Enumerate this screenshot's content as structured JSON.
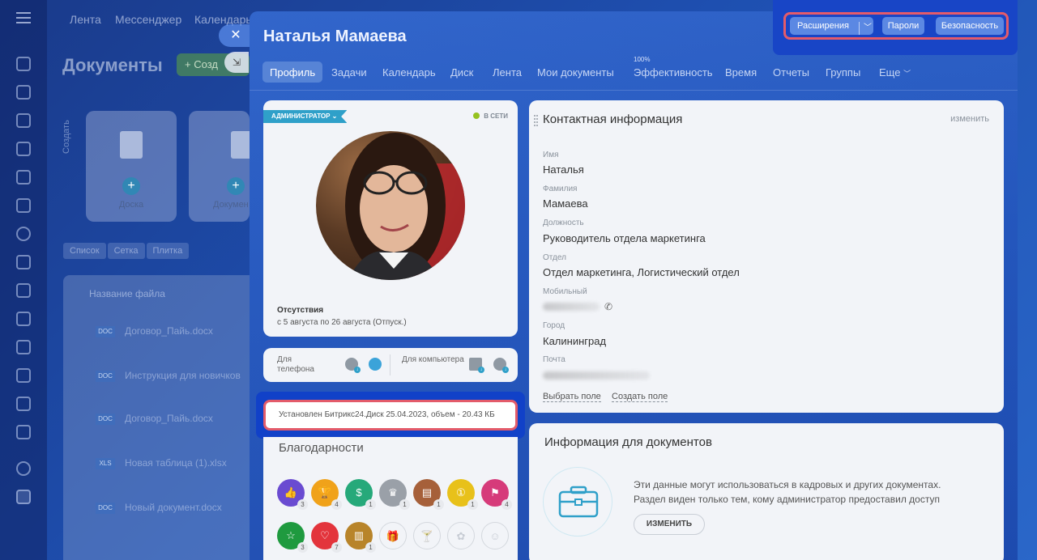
{
  "background": {
    "nav": [
      "Лента",
      "Мессенджер",
      "Календарь"
    ],
    "page_title": "Документы",
    "create_button": "Созд",
    "create_vertical": "Создать",
    "cards": [
      {
        "badge": "BOARD",
        "label": "Доска"
      },
      {
        "badge": "DOC",
        "label": "Докумен"
      }
    ],
    "views": [
      "Список",
      "Сетка",
      "Плитка"
    ],
    "table_header": "Название файла",
    "rows": [
      {
        "badge": "DOC",
        "name": "Договор_Пайь.docx"
      },
      {
        "badge": "DOC",
        "name": "Инструкция для новичков"
      },
      {
        "badge": "DOC",
        "name": "Договор_Пайь.docx"
      },
      {
        "badge": "XLS",
        "name": "Новая таблица (1).xlsx"
      },
      {
        "badge": "DOC",
        "name": "Новый документ.docx"
      }
    ],
    "close_symbol": "✕",
    "expand_symbol": "⇲"
  },
  "profile": {
    "title": "Наталья Мамаева",
    "tabs": [
      {
        "label": "Профиль",
        "active": true
      },
      {
        "label": "Задачи"
      },
      {
        "label": "Календарь"
      },
      {
        "label": "Диск"
      },
      {
        "label": "Лента"
      },
      {
        "label": "Мои документы"
      },
      {
        "label": "Эффективность",
        "superscript": "100%"
      },
      {
        "label": "Время"
      },
      {
        "label": "Отчеты"
      },
      {
        "label": "Группы"
      },
      {
        "label": "Еще"
      }
    ]
  },
  "avatar_card": {
    "role_badge": "АДМИНИСТРАТОР",
    "status": "В СЕТИ",
    "absence_title": "Отсутствия",
    "absence_text": "с 5 августа по 26 августа (Отпуск.)"
  },
  "apps_card": {
    "phone_label": "Для телефона",
    "computer_label": "Для компьютера"
  },
  "install_notice": "Установлен Битрикс24.Диск 25.04.2023, объем - 20.43 КБ",
  "thanks": {
    "title": "Благодарности",
    "row1": [
      {
        "icon": "thumbs-up",
        "count": "3",
        "color": "#6a4bd1"
      },
      {
        "icon": "trophy",
        "count": "4",
        "color": "#f0a21a"
      },
      {
        "icon": "money",
        "count": "1",
        "color": "#26a97a"
      },
      {
        "icon": "crown",
        "count": "1",
        "color": "#9aa0a8"
      },
      {
        "icon": "cake",
        "count": "1",
        "color": "#a6603a"
      },
      {
        "icon": "coin",
        "count": "1",
        "color": "#e8c11a"
      },
      {
        "icon": "flag",
        "count": "4",
        "color": "#d63b7a"
      }
    ],
    "row2": [
      {
        "icon": "star",
        "count": "3",
        "color": "#1f9a3f"
      },
      {
        "icon": "heart",
        "count": "7",
        "color": "#e3343c"
      },
      {
        "icon": "beer",
        "count": "1",
        "color": "#b8842a"
      },
      {
        "icon": "gift",
        "count": "",
        "color": ""
      },
      {
        "icon": "cocktail",
        "count": "",
        "color": ""
      },
      {
        "icon": "flower",
        "count": "",
        "color": ""
      },
      {
        "icon": "smile",
        "count": "",
        "color": ""
      }
    ]
  },
  "contact": {
    "title": "Контактная информация",
    "edit": "изменить",
    "fields": [
      {
        "label": "Имя",
        "value": "Наталья"
      },
      {
        "label": "Фамилия",
        "value": "Мамаева"
      },
      {
        "label": "Должность",
        "value": "Руководитель отдела маркетинга"
      },
      {
        "label": "Отдел",
        "value": "Отдел маркетинга, Логистический отдел"
      },
      {
        "label": "Мобильный",
        "value": ""
      },
      {
        "label": "Город",
        "value": "Калининград"
      },
      {
        "label": "Почта",
        "value": ""
      }
    ],
    "choose_field": "Выбрать поле",
    "create_field": "Создать поле"
  },
  "docs_info": {
    "title": "Информация для документов",
    "text_line1": "Эти данные могут использоваться в кадровых и других документах.",
    "text_line2": "Раздел виден только тем, кому администратор предоставил доступ",
    "button": "ИЗМЕНИТЬ"
  },
  "topbar": {
    "extensions": "Расширения",
    "passwords": "Пароли",
    "security": "Безопасность"
  },
  "colors": {
    "highlight": "#e35b6a",
    "accent": "#2fa0c9",
    "online": "#95c21f"
  }
}
